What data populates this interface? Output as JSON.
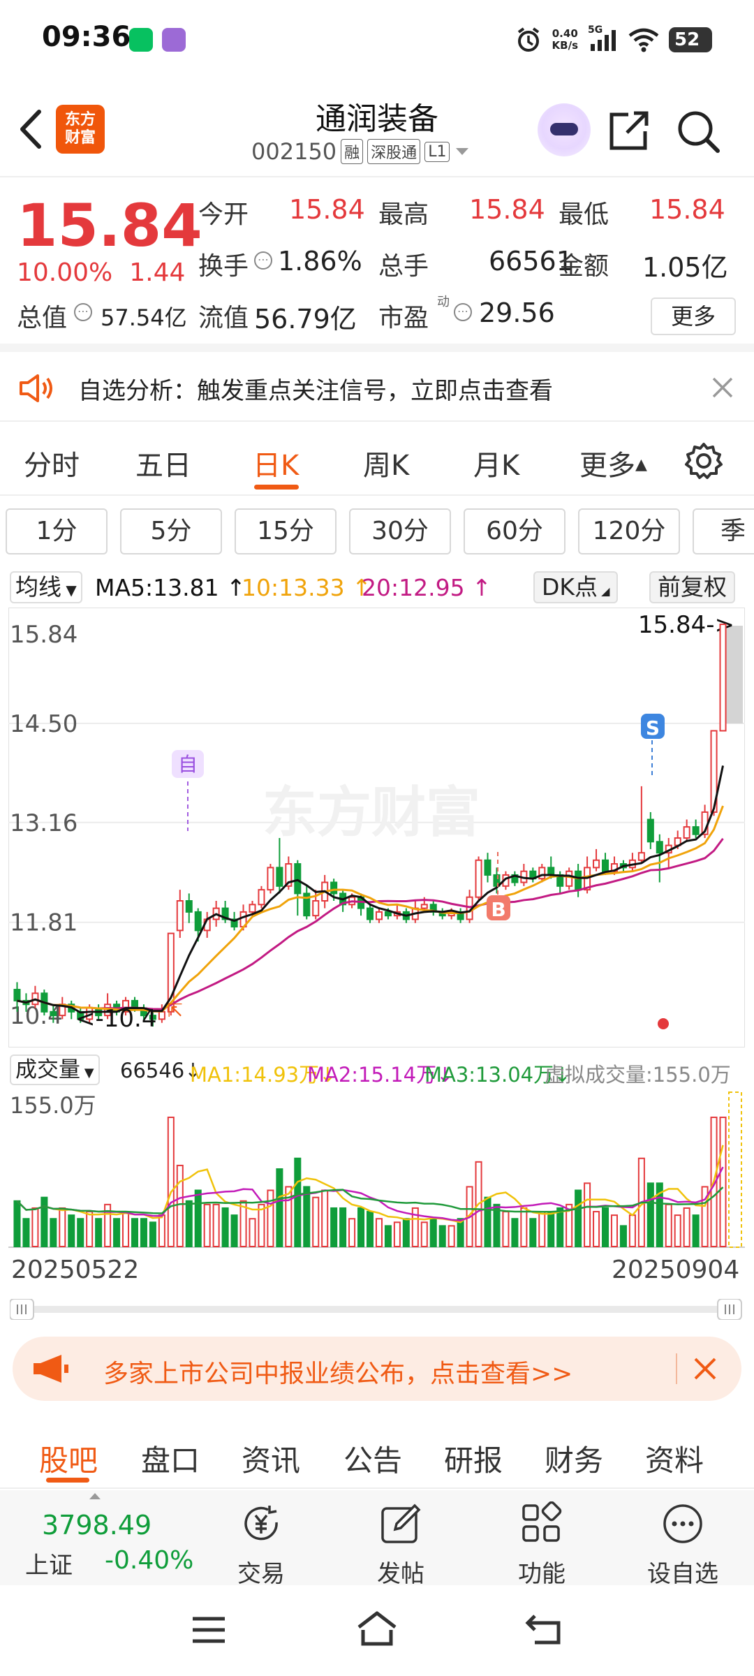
{
  "status_bar": {
    "time": "09:36",
    "net_speed_value": "0.40",
    "net_speed_unit": "KB/s",
    "signal_label": "5G",
    "battery": "52"
  },
  "header": {
    "logo_line1": "东方",
    "logo_line2": "财富",
    "stock_name": "通润装备",
    "stock_code": "002150",
    "tags": [
      "融",
      "深股通",
      "L1"
    ]
  },
  "quote": {
    "price": "15.84",
    "change_pct": "10.00%",
    "change_amt": "1.44",
    "open_label": "今开",
    "open": "15.84",
    "high_label": "最高",
    "high": "15.84",
    "low_label": "最低",
    "low": "15.84",
    "turnover_label": "换手",
    "turnover": "1.86%",
    "volume_label": "总手",
    "volume": "66561",
    "amount_label": "金额",
    "amount": "1.05亿",
    "mktcap_label": "总值",
    "mktcap": "57.54亿",
    "float_label": "流值",
    "float": "56.79亿",
    "pe_label": "市盈",
    "pe_sup": "动",
    "pe": "29.56",
    "more_label": "更多"
  },
  "notice": {
    "text": "自选分析：触发重点关注信号，立即点击查看"
  },
  "period_tabs": [
    "分时",
    "五日",
    "日K",
    "周K",
    "月K",
    "更多"
  ],
  "period_active": 2,
  "minute_tabs": [
    "1分",
    "5分",
    "15分",
    "30分",
    "60分",
    "120分",
    "季"
  ],
  "ma_row": {
    "selector": "均线",
    "ma5": "MA5:13.81",
    "ma10": "10:13.33",
    "ma20": "20:12.95",
    "dk_label": "DK点",
    "adjust_label": "前复权",
    "colors": {
      "ma5": "#111111",
      "ma10": "#f0a30a",
      "ma20": "#c21a83"
    }
  },
  "kline": {
    "ylabels": [
      "15.84",
      "14.50",
      "13.16",
      "11.81",
      "10.4"
    ],
    "last_price_tag": "15.84->",
    "low_tag": "<-10.4",
    "watermark": "东方财富",
    "marker_zi": "自",
    "marker_b": "B",
    "marker_s": "S"
  },
  "volume": {
    "selector": "成交量",
    "vol": "66546",
    "ma1": "MA1:14.93万",
    "ma2": "MA2:15.14万",
    "ma3": "MA3:13.04万",
    "virtual": "虚拟成交量:155.0万",
    "max_label": "155.0万",
    "colors": {
      "ma1": "#f0c20a",
      "ma2": "#c21ab8",
      "ma3": "#1f9a3a"
    }
  },
  "dates": {
    "start": "20250522",
    "end": "20250904"
  },
  "chart_data": {
    "type": "candlestick",
    "title": "",
    "x_range": [
      "20250522",
      "20250904"
    ],
    "ylim": [
      10.4,
      15.84
    ],
    "y_ticks": [
      15.84,
      14.5,
      13.16,
      11.81,
      10.4
    ],
    "candles": [
      {
        "o": 10.9,
        "c": 10.75,
        "h": 11.0,
        "l": 10.6
      },
      {
        "o": 10.75,
        "c": 10.7,
        "h": 10.85,
        "l": 10.6
      },
      {
        "o": 10.7,
        "c": 10.85,
        "h": 10.95,
        "l": 10.65
      },
      {
        "o": 10.85,
        "c": 10.6,
        "h": 10.9,
        "l": 10.55
      },
      {
        "o": 10.6,
        "c": 10.55,
        "h": 10.7,
        "l": 10.45
      },
      {
        "o": 10.55,
        "c": 10.7,
        "h": 10.8,
        "l": 10.5
      },
      {
        "o": 10.7,
        "c": 10.6,
        "h": 10.75,
        "l": 10.5
      },
      {
        "o": 10.6,
        "c": 10.5,
        "h": 10.65,
        "l": 10.45
      },
      {
        "o": 10.5,
        "c": 10.65,
        "h": 10.7,
        "l": 10.45
      },
      {
        "o": 10.65,
        "c": 10.55,
        "h": 10.7,
        "l": 10.5
      },
      {
        "o": 10.55,
        "c": 10.7,
        "h": 10.85,
        "l": 10.5
      },
      {
        "o": 10.7,
        "c": 10.6,
        "h": 10.75,
        "l": 10.55
      },
      {
        "o": 10.6,
        "c": 10.75,
        "h": 10.8,
        "l": 10.55
      },
      {
        "o": 10.75,
        "c": 10.65,
        "h": 10.8,
        "l": 10.6
      },
      {
        "o": 10.65,
        "c": 10.55,
        "h": 10.7,
        "l": 10.5
      },
      {
        "o": 10.55,
        "c": 10.5,
        "h": 10.6,
        "l": 10.4
      },
      {
        "o": 10.5,
        "c": 10.6,
        "h": 10.7,
        "l": 10.45
      },
      {
        "o": 10.6,
        "c": 11.66,
        "h": 11.66,
        "l": 10.55
      },
      {
        "o": 11.7,
        "c": 12.1,
        "h": 12.25,
        "l": 11.6
      },
      {
        "o": 12.1,
        "c": 11.95,
        "h": 12.2,
        "l": 11.8
      },
      {
        "o": 11.95,
        "c": 11.7,
        "h": 12.0,
        "l": 11.55
      },
      {
        "o": 11.7,
        "c": 11.85,
        "h": 11.95,
        "l": 11.6
      },
      {
        "o": 11.85,
        "c": 12.0,
        "h": 12.1,
        "l": 11.75
      },
      {
        "o": 12.0,
        "c": 11.85,
        "h": 12.1,
        "l": 11.8
      },
      {
        "o": 11.85,
        "c": 11.75,
        "h": 11.95,
        "l": 11.7
      },
      {
        "o": 11.75,
        "c": 11.95,
        "h": 12.05,
        "l": 11.7
      },
      {
        "o": 11.95,
        "c": 12.05,
        "h": 12.1,
        "l": 11.9
      },
      {
        "o": 12.05,
        "c": 12.25,
        "h": 12.3,
        "l": 12.0
      },
      {
        "o": 12.25,
        "c": 12.55,
        "h": 12.6,
        "l": 12.2
      },
      {
        "o": 12.55,
        "c": 12.3,
        "h": 12.95,
        "l": 12.2
      },
      {
        "o": 12.3,
        "c": 12.6,
        "h": 12.7,
        "l": 12.25
      },
      {
        "o": 12.6,
        "c": 12.2,
        "h": 12.65,
        "l": 11.9
      },
      {
        "o": 12.2,
        "c": 11.9,
        "h": 12.3,
        "l": 11.85
      },
      {
        "o": 11.9,
        "c": 12.1,
        "h": 12.25,
        "l": 11.85
      },
      {
        "o": 12.1,
        "c": 12.35,
        "h": 12.45,
        "l": 12.0
      },
      {
        "o": 12.35,
        "c": 12.2,
        "h": 12.4,
        "l": 12.1
      },
      {
        "o": 12.2,
        "c": 12.05,
        "h": 12.25,
        "l": 11.95
      },
      {
        "o": 12.05,
        "c": 12.15,
        "h": 12.2,
        "l": 12.0
      },
      {
        "o": 12.15,
        "c": 12.0,
        "h": 12.2,
        "l": 11.9
      },
      {
        "o": 12.0,
        "c": 11.85,
        "h": 12.05,
        "l": 11.8
      },
      {
        "o": 11.85,
        "c": 11.95,
        "h": 12.0,
        "l": 11.8
      },
      {
        "o": 11.95,
        "c": 11.9,
        "h": 12.0,
        "l": 11.85
      },
      {
        "o": 11.9,
        "c": 11.95,
        "h": 12.05,
        "l": 11.85
      },
      {
        "o": 11.95,
        "c": 11.85,
        "h": 12.0,
        "l": 11.8
      },
      {
        "o": 11.85,
        "c": 12.0,
        "h": 12.1,
        "l": 11.8
      },
      {
        "o": 12.0,
        "c": 12.05,
        "h": 12.15,
        "l": 11.95
      },
      {
        "o": 12.05,
        "c": 11.95,
        "h": 12.1,
        "l": 11.9
      },
      {
        "o": 11.95,
        "c": 11.9,
        "h": 12.0,
        "l": 11.85
      },
      {
        "o": 11.9,
        "c": 11.95,
        "h": 12.0,
        "l": 11.85
      },
      {
        "o": 11.95,
        "c": 11.85,
        "h": 12.0,
        "l": 11.8
      },
      {
        "o": 11.85,
        "c": 12.15,
        "h": 12.25,
        "l": 11.8
      },
      {
        "o": 12.15,
        "c": 12.65,
        "h": 12.7,
        "l": 12.1
      },
      {
        "o": 12.65,
        "c": 12.45,
        "h": 12.75,
        "l": 12.35
      },
      {
        "o": 12.45,
        "c": 12.3,
        "h": 12.55,
        "l": 12.2
      },
      {
        "o": 12.3,
        "c": 12.45,
        "h": 12.5,
        "l": 12.25
      },
      {
        "o": 12.45,
        "c": 12.35,
        "h": 12.5,
        "l": 12.3
      },
      {
        "o": 12.35,
        "c": 12.5,
        "h": 12.6,
        "l": 12.3
      },
      {
        "o": 12.5,
        "c": 12.4,
        "h": 12.55,
        "l": 12.35
      },
      {
        "o": 12.4,
        "c": 12.55,
        "h": 12.6,
        "l": 12.35
      },
      {
        "o": 12.55,
        "c": 12.45,
        "h": 12.7,
        "l": 12.4
      },
      {
        "o": 12.45,
        "c": 12.3,
        "h": 12.5,
        "l": 12.2
      },
      {
        "o": 12.3,
        "c": 12.5,
        "h": 12.55,
        "l": 12.25
      },
      {
        "o": 12.5,
        "c": 12.25,
        "h": 12.6,
        "l": 12.15
      },
      {
        "o": 12.25,
        "c": 12.55,
        "h": 12.7,
        "l": 12.2
      },
      {
        "o": 12.55,
        "c": 12.65,
        "h": 12.8,
        "l": 12.5
      },
      {
        "o": 12.65,
        "c": 12.5,
        "h": 12.75,
        "l": 12.45
      },
      {
        "o": 12.5,
        "c": 12.6,
        "h": 12.7,
        "l": 12.45
      },
      {
        "o": 12.6,
        "c": 12.55,
        "h": 12.65,
        "l": 12.5
      },
      {
        "o": 12.55,
        "c": 12.65,
        "h": 12.75,
        "l": 12.5
      },
      {
        "o": 12.65,
        "c": 12.75,
        "h": 13.65,
        "l": 12.6
      },
      {
        "o": 13.2,
        "c": 12.9,
        "h": 13.3,
        "l": 12.8
      },
      {
        "o": 12.9,
        "c": 12.75,
        "h": 13.0,
        "l": 12.35
      },
      {
        "o": 12.75,
        "c": 12.85,
        "h": 12.95,
        "l": 12.55
      },
      {
        "o": 12.85,
        "c": 12.95,
        "h": 13.05,
        "l": 12.8
      },
      {
        "o": 12.95,
        "c": 13.1,
        "h": 13.2,
        "l": 12.9
      },
      {
        "o": 13.1,
        "c": 13.0,
        "h": 13.2,
        "l": 12.95
      },
      {
        "o": 13.0,
        "c": 13.3,
        "h": 13.4,
        "l": 12.95
      },
      {
        "o": 13.3,
        "c": 14.4,
        "h": 14.4,
        "l": 13.25
      },
      {
        "o": 14.4,
        "c": 15.84,
        "h": 15.84,
        "l": 14.4
      }
    ],
    "series": [
      {
        "name": "MA5",
        "last": 13.81
      },
      {
        "name": "MA10",
        "last": 13.33
      },
      {
        "name": "MA20",
        "last": 12.95
      }
    ]
  },
  "bottom_banner": {
    "text": "多家上市公司中报业绩公布，点击查看>>"
  },
  "bottom_tabs": [
    "股吧",
    "盘口",
    "资讯",
    "公告",
    "研报",
    "财务",
    "资料"
  ],
  "toolbar": {
    "index_value": "3798.49",
    "index_name": "上证",
    "index_change": "-0.40%",
    "trade": "交易",
    "post": "发帖",
    "func": "功能",
    "watch": "设自选"
  }
}
